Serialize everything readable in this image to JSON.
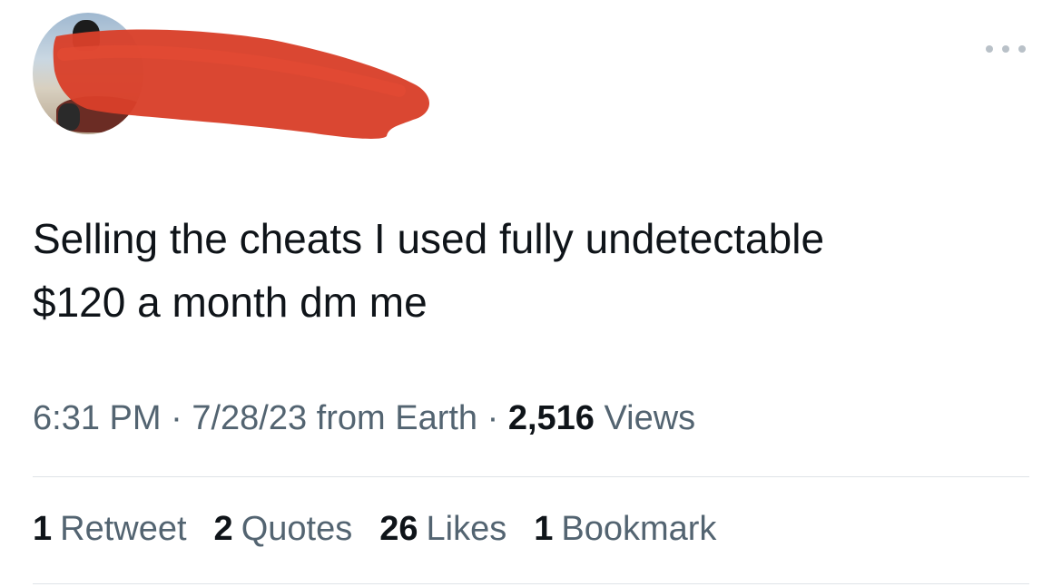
{
  "tweet": {
    "text": "Selling the cheats I used fully undetectable\n$120 a month dm me",
    "time": "6:31 PM",
    "sep1": " · ",
    "date": "7/28/23",
    "source": " from Earth",
    "sep2": " · ",
    "views_count": "2,516",
    "views_label": " Views"
  },
  "stats": [
    {
      "count": "1",
      "label": "Retweet"
    },
    {
      "count": "2",
      "label": "Quotes"
    },
    {
      "count": "26",
      "label": "Likes"
    },
    {
      "count": "1",
      "label": "Bookmark"
    }
  ],
  "colors": {
    "text": "#0f1419",
    "secondary": "#536471",
    "redaction": "#d9402a",
    "divider": "#dfe3e7"
  },
  "icons": {
    "more": "more-horizontal-icon"
  }
}
